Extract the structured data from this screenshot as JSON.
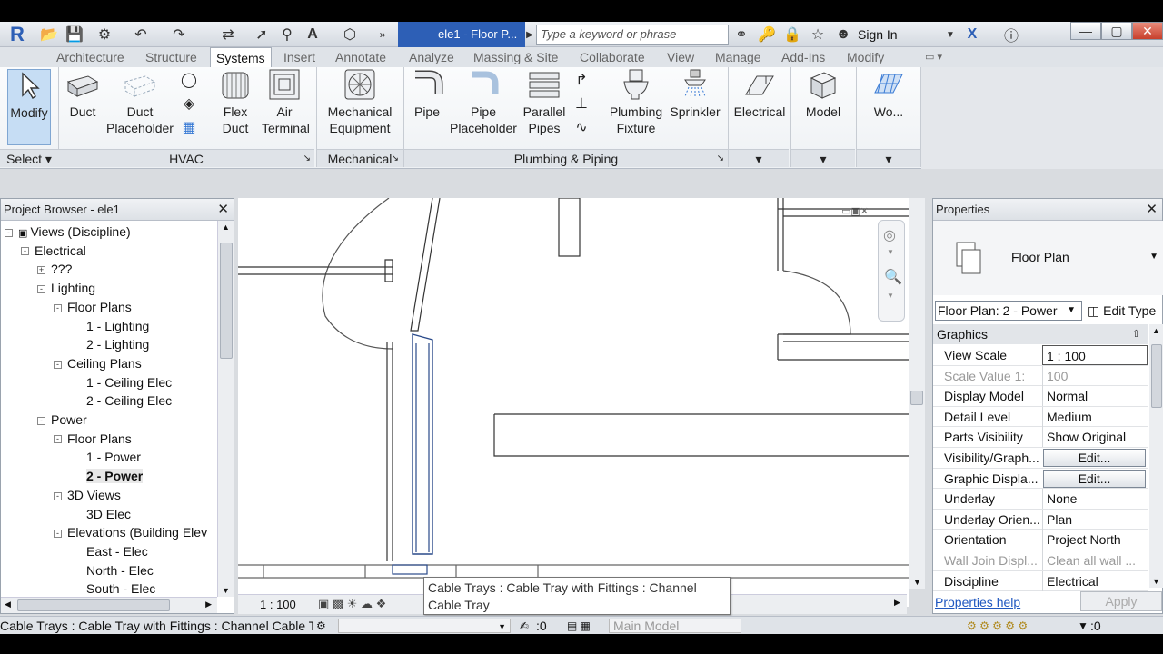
{
  "titlebar": {
    "doc_title": "ele1 - Floor P...",
    "search_placeholder": "Type a keyword or phrase",
    "sign_in": "Sign In"
  },
  "tabs": [
    "Architecture",
    "Structure",
    "Systems",
    "Insert",
    "Annotate",
    "Analyze",
    "Massing & Site",
    "Collaborate",
    "View",
    "Manage",
    "Add-Ins",
    "Modify"
  ],
  "active_tab": "Systems",
  "ribbon": {
    "modify": "Modify",
    "duct": "Duct",
    "duct_placeholder": [
      "Duct",
      "Placeholder"
    ],
    "flex_duct": [
      "Flex",
      "Duct"
    ],
    "air_terminal": [
      "Air",
      "Terminal"
    ],
    "mechanical_equipment": [
      "Mechanical",
      "Equipment"
    ],
    "pipe": "Pipe",
    "pipe_placeholder": [
      "Pipe",
      "Placeholder"
    ],
    "parallel_pipes": [
      "Parallel",
      "Pipes"
    ],
    "plumbing_fixture": [
      "Plumbing",
      "Fixture"
    ],
    "sprinkler": "Sprinkler",
    "electrical": "Electrical",
    "model": "Model",
    "work": "Wo...",
    "panels": {
      "select": "Select",
      "hvac": "HVAC",
      "mechanical": "Mechanical",
      "plumbing": "Plumbing & Piping"
    }
  },
  "browser": {
    "title": "Project Browser - ele1",
    "items": [
      {
        "label": "Views (Discipline)",
        "level": 0,
        "exp": "-"
      },
      {
        "label": "Electrical",
        "level": 1,
        "exp": "-"
      },
      {
        "label": "???",
        "level": 2,
        "exp": "+"
      },
      {
        "label": "Lighting",
        "level": 2,
        "exp": "-"
      },
      {
        "label": "Floor Plans",
        "level": 3,
        "exp": "-"
      },
      {
        "label": "1 - Lighting",
        "level": 4,
        "exp": ""
      },
      {
        "label": "2 - Lighting",
        "level": 4,
        "exp": ""
      },
      {
        "label": "Ceiling Plans",
        "level": 3,
        "exp": "-"
      },
      {
        "label": "1 - Ceiling Elec",
        "level": 4,
        "exp": ""
      },
      {
        "label": "2 - Ceiling Elec",
        "level": 4,
        "exp": ""
      },
      {
        "label": "Power",
        "level": 2,
        "exp": "-"
      },
      {
        "label": "Floor Plans",
        "level": 3,
        "exp": "-"
      },
      {
        "label": "1 - Power",
        "level": 4,
        "exp": ""
      },
      {
        "label": "2 - Power",
        "level": 4,
        "exp": "",
        "selected": true
      },
      {
        "label": "3D Views",
        "level": 3,
        "exp": "-"
      },
      {
        "label": "3D Elec",
        "level": 4,
        "exp": ""
      },
      {
        "label": "Elevations (Building Elev",
        "level": 3,
        "exp": "-"
      },
      {
        "label": "East - Elec",
        "level": 4,
        "exp": ""
      },
      {
        "label": "North - Elec",
        "level": 4,
        "exp": ""
      },
      {
        "label": "South - Elec",
        "level": 4,
        "exp": ""
      }
    ]
  },
  "view": {
    "scale": "1 : 100",
    "tooltip": "Cable Trays : Cable Tray with Fittings : Channel Cable Tray"
  },
  "properties": {
    "title": "Properties",
    "type_name": "Floor Plan",
    "selector": "Floor Plan: 2 - Power",
    "edit_type": "Edit Type",
    "group": "Graphics",
    "rows": [
      {
        "k": "View Scale",
        "v": "1 : 100",
        "boxed": true
      },
      {
        "k": "Scale Value   1:",
        "v": "100",
        "dim": true
      },
      {
        "k": "Display Model",
        "v": "Normal"
      },
      {
        "k": "Detail Level",
        "v": "Medium"
      },
      {
        "k": "Parts Visibility",
        "v": "Show Original"
      },
      {
        "k": "Visibility/Graph...",
        "v": "Edit...",
        "button": true
      },
      {
        "k": "Graphic Displa...",
        "v": "Edit...",
        "button": true
      },
      {
        "k": "Underlay",
        "v": "None"
      },
      {
        "k": "Underlay Orien...",
        "v": "Plan"
      },
      {
        "k": "Orientation",
        "v": "Project North"
      },
      {
        "k": "Wall Join Displ...",
        "v": "Clean all wall ...",
        "dim": true
      },
      {
        "k": "Discipline",
        "v": "Electrical"
      }
    ],
    "help": "Properties help",
    "apply": "Apply"
  },
  "status": {
    "message": "Cable Trays : Cable Tray with Fittings : Channel Cable Tr",
    "count": ":0",
    "model": "Main Model",
    "filter": ":0"
  }
}
